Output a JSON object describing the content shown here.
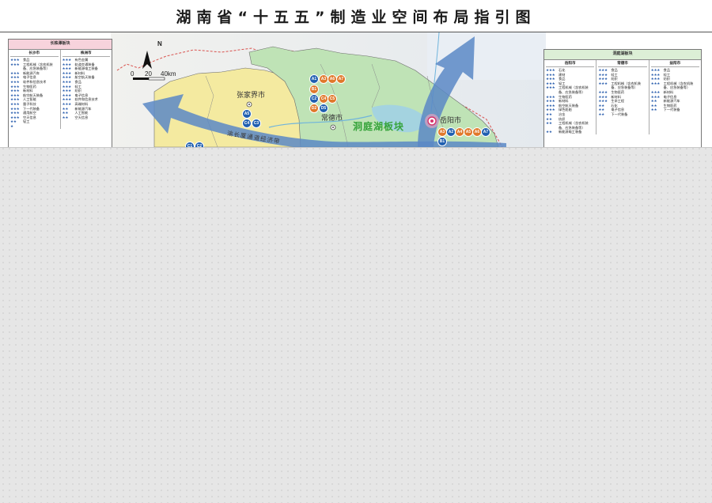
{
  "title": "湖南省“十五五”制造业空间布局指引图",
  "map": {
    "north_label": "N",
    "scale": {
      "ticks": [
        "0",
        "20",
        "40km"
      ]
    },
    "region_label": "洞庭湖板块",
    "corridor_label": "渝长厦通道经济带",
    "cities": [
      {
        "id": "zhangjiajie",
        "name": "张家界市"
      },
      {
        "id": "changde",
        "name": "常德市"
      },
      {
        "id": "yueyang",
        "name": "岳阳市"
      }
    ],
    "badges": {
      "changde_orange": [
        "A1",
        "A3",
        "A6",
        "A7"
      ],
      "changde_mixed": [
        {
          "code": "B1",
          "color": "orange"
        },
        {
          "code": "C2",
          "color": "blue"
        },
        {
          "code": "C4",
          "color": "orange"
        },
        {
          "code": "C5",
          "color": "orange"
        },
        {
          "code": "D2",
          "color": "orange"
        },
        {
          "code": "D5",
          "color": "blue"
        }
      ],
      "zhangjiajie": [
        "A5",
        "C4",
        "C3"
      ],
      "yueyang": [
        {
          "code": "A3",
          "color": "orange"
        },
        {
          "code": "A2",
          "color": "blue"
        },
        {
          "code": "A4",
          "color": "orange"
        },
        {
          "code": "A5",
          "color": "orange"
        },
        {
          "code": "A6",
          "color": "orange"
        },
        {
          "code": "A7",
          "color": "blue"
        },
        {
          "code": "B1",
          "color": "blue"
        }
      ],
      "bottom_left": [
        "C1",
        "C2"
      ]
    },
    "colors": {
      "dongting_region": "#bfe3b6",
      "changzhutan_region": "#f4eaa0",
      "arrow": "#5b88c6",
      "badge_blue": "#1f5fb0",
      "badge_orange": "#e0782a"
    }
  },
  "legend_left": {
    "title": "长株潭板块",
    "columns": [
      {
        "title": "长沙市",
        "rows": [
          {
            "stars": "★★★",
            "name": "食品"
          },
          {
            "stars": "★★★",
            "name": "工程机械（含农机装备、应急装备等）"
          },
          {
            "stars": "★★★",
            "name": "新能源汽车"
          },
          {
            "stars": "★★★",
            "name": "电子信息"
          },
          {
            "stars": "★★★",
            "name": "软件和信息技术"
          },
          {
            "stars": "★★★",
            "name": "生物医药"
          },
          {
            "stars": "★★★",
            "name": "新材料"
          },
          {
            "stars": "★★★",
            "name": "航空航天装备"
          },
          {
            "stars": "★★★",
            "name": "人工智能"
          },
          {
            "stars": "★★★",
            "name": "量子科技"
          },
          {
            "stars": "★★★",
            "name": "下一代装备"
          },
          {
            "stars": "★★★",
            "name": "通用航空"
          },
          {
            "stars": "★★★",
            "name": "空天信息"
          },
          {
            "stars": "★★",
            "name": "轻工"
          },
          {
            "stars": "★",
            "name": ""
          }
        ]
      },
      {
        "title": "株洲市",
        "rows": [
          {
            "stars": "★★★",
            "name": "有色金属"
          },
          {
            "stars": "★★★",
            "name": "轨道交通装备"
          },
          {
            "stars": "★★★",
            "name": "新能源电工装备"
          },
          {
            "stars": "★★★",
            "name": "新材料"
          },
          {
            "stars": "★★★",
            "name": "航空航天装备"
          },
          {
            "stars": "★★★",
            "name": "食品"
          },
          {
            "stars": "★★★",
            "name": "轻工"
          },
          {
            "stars": "★★★",
            "name": "纺织"
          },
          {
            "stars": "★★★",
            "name": "电子信息"
          },
          {
            "stars": "★★★",
            "name": "软件和信息技术"
          },
          {
            "stars": "★★★",
            "name": "高端材料"
          },
          {
            "stars": "★★",
            "name": "新能源汽车"
          },
          {
            "stars": "★★",
            "name": "人工智能"
          },
          {
            "stars": "★★",
            "name": "空天信息"
          }
        ]
      }
    ]
  },
  "legend_right": {
    "title": "洞庭湖板块",
    "columns": [
      {
        "title": "岳阳市",
        "rows": [
          {
            "stars": "★★★",
            "name": "石化"
          },
          {
            "stars": "★★★",
            "name": "建材"
          },
          {
            "stars": "★★★",
            "name": "食品"
          },
          {
            "stars": "★★★",
            "name": "轻工"
          },
          {
            "stars": "★★★",
            "name": "工程机械（含农机装备、应急装备等）"
          },
          {
            "stars": "★★★",
            "name": "生物医药"
          },
          {
            "stars": "★★★",
            "name": "新材料"
          },
          {
            "stars": "★★★",
            "name": "航空航天装备"
          },
          {
            "stars": "★★★",
            "name": "绿色船舶"
          },
          {
            "stars": "★★",
            "name": "冶金"
          },
          {
            "stars": "★★",
            "name": "纺织"
          },
          {
            "stars": "★★",
            "name": "工程机械（含农机装备、应急装备等）"
          },
          {
            "stars": "★★",
            "name": "新能源电工装备"
          }
        ]
      },
      {
        "title": "常德市",
        "rows": [
          {
            "stars": "★★★",
            "name": "食品"
          },
          {
            "stars": "★★★",
            "name": "轻工"
          },
          {
            "stars": "★★★",
            "name": "纺织"
          },
          {
            "stars": "★★★",
            "name": "工程机械（含农机装备、应急装备等）"
          },
          {
            "stars": "★★★",
            "name": "生物医药"
          },
          {
            "stars": "★★★",
            "name": "新材料"
          },
          {
            "stars": "★★★",
            "name": "生命工程"
          },
          {
            "stars": "★★",
            "name": "石化"
          },
          {
            "stars": "★★",
            "name": "电子信息"
          },
          {
            "stars": "★★",
            "name": "下一代装备"
          }
        ]
      },
      {
        "title": "益阳市",
        "rows": [
          {
            "stars": "★★★",
            "name": "食品"
          },
          {
            "stars": "★★★",
            "name": "轻工"
          },
          {
            "stars": "★★★",
            "name": "纺织"
          },
          {
            "stars": "★★★",
            "name": "工程机械（含农机装备、应急装备等）"
          },
          {
            "stars": "★★★",
            "name": "新材料"
          },
          {
            "stars": "★★★",
            "name": "电子信息"
          },
          {
            "stars": "★★",
            "name": "新能源汽车"
          },
          {
            "stars": "★★",
            "name": "生物医药"
          },
          {
            "stars": "★★",
            "name": "下一代装备"
          }
        ]
      }
    ]
  }
}
